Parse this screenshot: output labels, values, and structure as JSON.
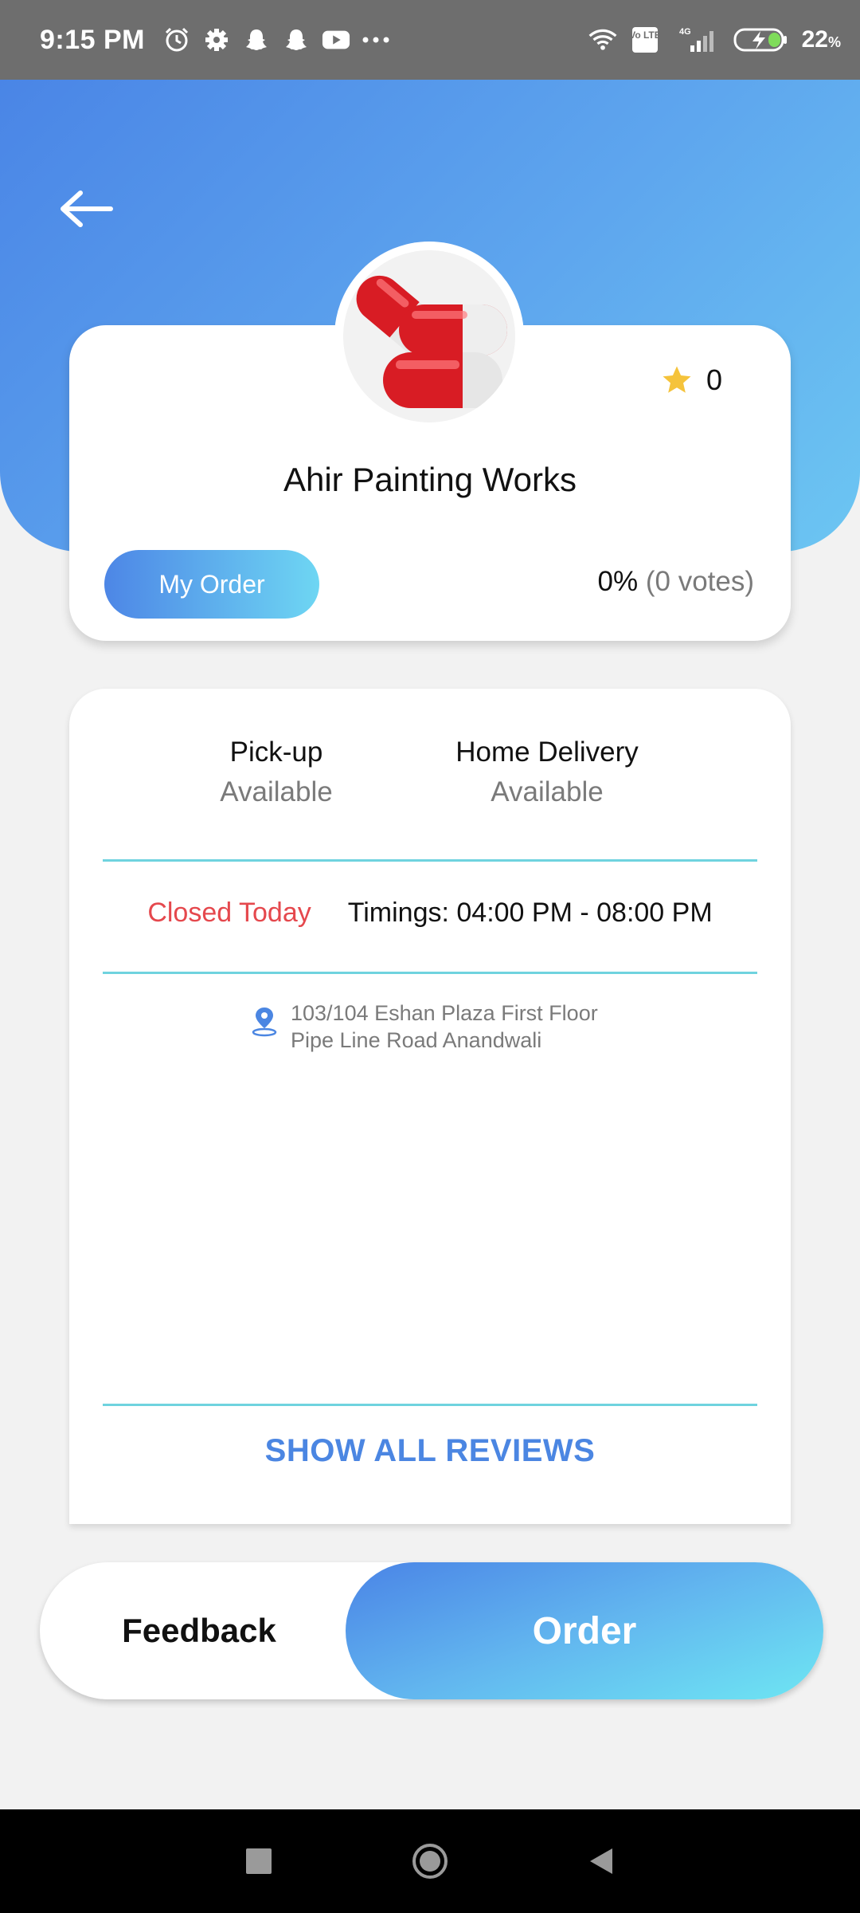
{
  "status_bar": {
    "time": "9:15 PM",
    "left_icons": [
      "alarm-icon",
      "settings-icon",
      "snapchat-icon",
      "snapchat-icon",
      "youtube-icon",
      "more-icon"
    ],
    "right_icons": [
      "wifi-icon",
      "volte-icon",
      "signal-icon",
      "battery-charging-icon"
    ],
    "network_label": "4G",
    "volte_label": "Vo LTE",
    "battery_percent": "22",
    "battery_unit": "%"
  },
  "header": {
    "back_icon": "arrow-left-icon",
    "gradient_colors": [
      "#4a85e6",
      "#6cc6f2"
    ]
  },
  "profile": {
    "avatar_icon": "capsule-pills-icon",
    "rating_icon": "star-icon",
    "rating": "0",
    "shop_name": "Ahir Painting Works",
    "my_order_label": "My Order",
    "votes_percent": "0%",
    "votes_count": "(0 votes)"
  },
  "services": [
    {
      "title": "Pick-up",
      "status": "Available"
    },
    {
      "title": "Home Delivery",
      "status": "Available"
    }
  ],
  "hours": {
    "closed_label": "Closed Today",
    "timings": "Timings: 04:00 PM - 08:00 PM"
  },
  "address": {
    "icon": "location-pin-icon",
    "line1": "103/104 Eshan Plaza First Floor",
    "line2": "Pipe Line Road Anandwali"
  },
  "reviews": {
    "show_all_label": "SHOW ALL REVIEWS"
  },
  "actions": {
    "feedback_label": "Feedback",
    "order_label": "Order"
  },
  "colors": {
    "accent": "#4b86e2",
    "accent_light": "#6ed6f3",
    "closed": "#e5484d",
    "divider": "#6fd3df"
  },
  "nav_bar": {
    "icons": [
      "recent-apps-icon",
      "home-icon",
      "back-icon"
    ]
  }
}
